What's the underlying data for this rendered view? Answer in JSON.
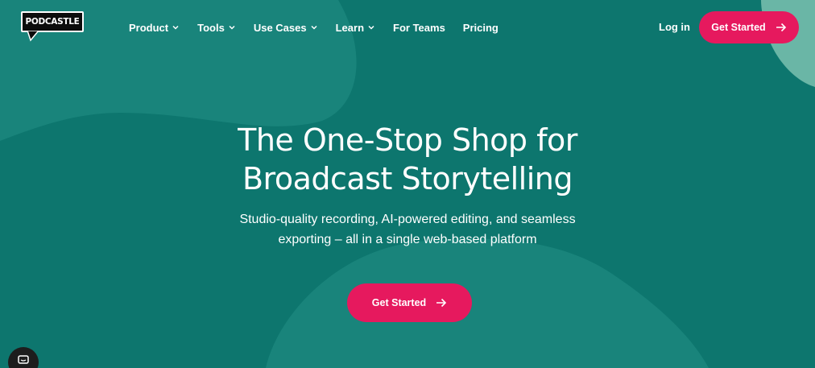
{
  "nav": {
    "logo_text": "PODCASTLE",
    "menu": [
      {
        "label": "Product",
        "has_dropdown": true
      },
      {
        "label": "Tools",
        "has_dropdown": true
      },
      {
        "label": "Use Cases",
        "has_dropdown": true
      },
      {
        "label": "Learn",
        "has_dropdown": true
      },
      {
        "label": "For Teams",
        "has_dropdown": false
      },
      {
        "label": "Pricing",
        "has_dropdown": false
      }
    ],
    "login_label": "Log in",
    "cta_label": "Get Started"
  },
  "hero": {
    "headline_line1": "The One-Stop Shop for",
    "headline_line2": "Broadcast Storytelling",
    "subhead": "Studio-quality recording, AI-powered editing, and seamless exporting – all in a single web-based platform",
    "cta_label": "Get Started"
  },
  "icons": {
    "chevron": "chevron-down-icon",
    "arrow": "arrow-right-icon",
    "chat": "chat-icon"
  },
  "colors": {
    "background": "#0d766e",
    "accent": "#e6195e",
    "blob": "#2a8c83",
    "corner_blob": "#6ab6a6"
  }
}
